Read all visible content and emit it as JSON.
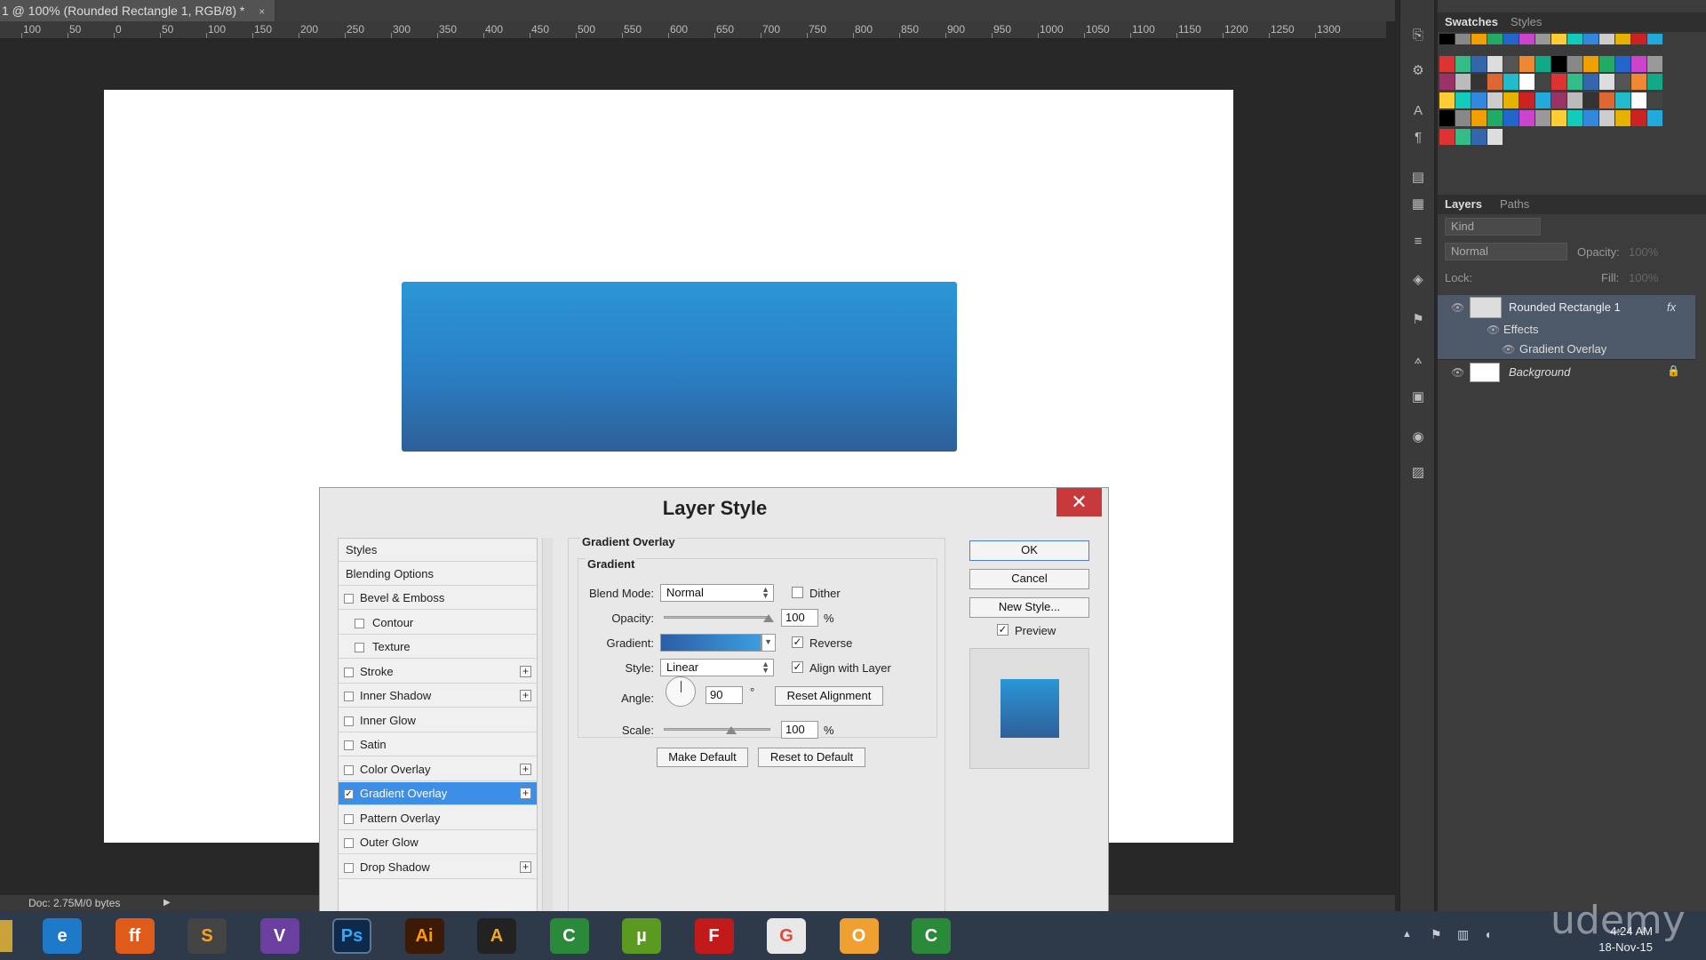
{
  "document": {
    "tab_title": "1 @ 100% (Rounded Rectangle 1, RGB/8) *",
    "tab_close": "×"
  },
  "ruler": [
    "100",
    "50",
    "0",
    "50",
    "100",
    "150",
    "200",
    "250",
    "300",
    "350",
    "400",
    "450",
    "500",
    "550",
    "600",
    "650",
    "700",
    "750",
    "800",
    "850",
    "900",
    "950",
    "1000",
    "1050",
    "1100",
    "1150",
    "1200",
    "1250",
    "1300"
  ],
  "colors": {
    "shape_top": "#2b96d6",
    "shape_bottom": "#2e5f98",
    "selection": "#3d8ee6",
    "close_red": "#c7393a"
  },
  "panels": {
    "swatches_tab": "Swatches",
    "styles_tab": "Styles",
    "layers_tab": "Layers",
    "paths_tab": "Paths",
    "kind_filter": "Kind",
    "blend_mode": "Normal",
    "opacity_label": "Opacity:",
    "opacity_value": "100%",
    "lock_label": "Lock:",
    "fill_label": "Fill:",
    "fill_value": "100%",
    "layers": [
      {
        "name": "Rounded Rectangle 1",
        "fx": "fx"
      },
      {
        "name": "Effects"
      },
      {
        "name": "Gradient Overlay"
      },
      {
        "name": "Background"
      }
    ]
  },
  "dialog": {
    "title": "Layer Style",
    "close": "✕",
    "styles_header": "Styles",
    "blending_options": "Blending Options",
    "style_items": [
      {
        "label": "Bevel & Emboss",
        "checked": false,
        "plus": false
      },
      {
        "label": "Contour",
        "checked": false,
        "plus": false,
        "indent": true
      },
      {
        "label": "Texture",
        "checked": false,
        "plus": false,
        "indent": true
      },
      {
        "label": "Stroke",
        "checked": false,
        "plus": true
      },
      {
        "label": "Inner Shadow",
        "checked": false,
        "plus": true
      },
      {
        "label": "Inner Glow",
        "checked": false,
        "plus": false
      },
      {
        "label": "Satin",
        "checked": false,
        "plus": false
      },
      {
        "label": "Color Overlay",
        "checked": false,
        "plus": true
      },
      {
        "label": "Gradient Overlay",
        "checked": true,
        "plus": true,
        "selected": true
      },
      {
        "label": "Pattern Overlay",
        "checked": false,
        "plus": false
      },
      {
        "label": "Outer Glow",
        "checked": false,
        "plus": false
      },
      {
        "label": "Drop Shadow",
        "checked": false,
        "plus": true
      }
    ],
    "section_title": "Gradient Overlay",
    "group_title": "Gradient",
    "blend_mode_label": "Blend Mode:",
    "blend_mode_value": "Normal",
    "dither_label": "Dither",
    "opacity_label": "Opacity:",
    "opacity_value": "100",
    "opacity_unit": "%",
    "gradient_label": "Gradient:",
    "reverse_label": "Reverse",
    "style_label": "Style:",
    "style_value": "Linear",
    "align_label": "Align with Layer",
    "angle_label": "Angle:",
    "angle_value": "90",
    "angle_unit": "°",
    "reset_alignment": "Reset Alignment",
    "scale_label": "Scale:",
    "scale_value": "100",
    "scale_unit": "%",
    "make_default": "Make Default",
    "reset_default": "Reset to Default",
    "ok": "OK",
    "cancel": "Cancel",
    "new_style": "New Style...",
    "preview_label": "Preview",
    "checkmark": "✓"
  },
  "status": {
    "doc_size": "Doc: 2.75M/0 bytes",
    "arrow": "▶"
  },
  "taskbar": {
    "apps": [
      "e",
      "ff",
      "S",
      "V",
      "Ps",
      "Ai",
      "A",
      "C",
      "µ",
      "F",
      "G",
      "O",
      "C"
    ],
    "time": "4:24 AM",
    "date": "18-Nov-15"
  },
  "watermark": "udemy"
}
